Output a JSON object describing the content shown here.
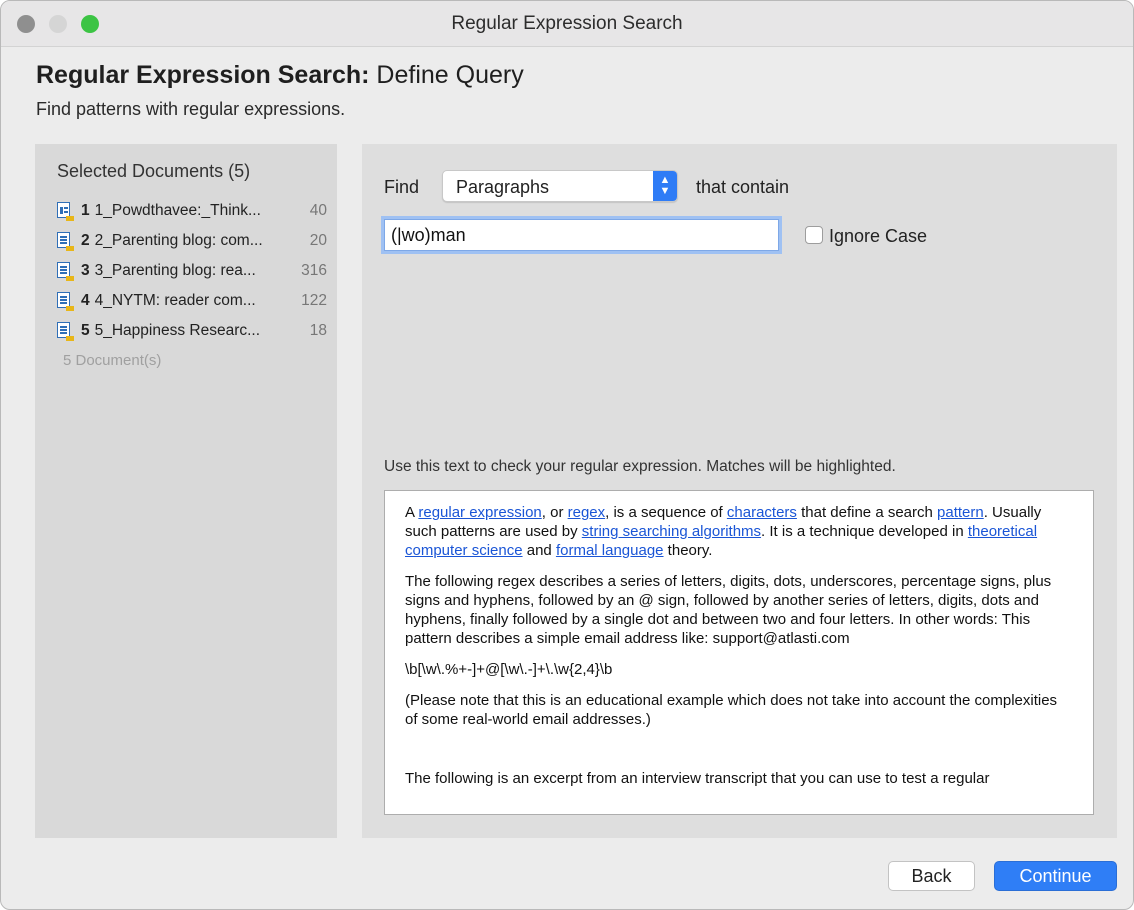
{
  "window": {
    "title": "Regular Expression Search",
    "colors": {
      "close": "#8f8f8f",
      "minimize": "#d5d5d5",
      "maximize": "#3cc444",
      "accent": "#2f7ef6"
    }
  },
  "header": {
    "title_bold": "Regular Expression Search:",
    "title_rest": " Define Query",
    "subtitle": "Find patterns with regular expressions."
  },
  "documents": {
    "title": "Selected Documents (5)",
    "items": [
      {
        "num": "1",
        "name": "1_Powdthavee:_Think...",
        "count": "40",
        "icon": "pdf-document-icon"
      },
      {
        "num": "2",
        "name": "2_Parenting blog: com...",
        "count": "20",
        "icon": "text-document-icon"
      },
      {
        "num": "3",
        "name": "3_Parenting blog: rea...",
        "count": "316",
        "icon": "text-document-icon"
      },
      {
        "num": "4",
        "name": "4_NYTM: reader com...",
        "count": "122",
        "icon": "text-document-icon"
      },
      {
        "num": "5",
        "name": "5_Happiness Researc...",
        "count": "18",
        "icon": "text-document-icon"
      }
    ],
    "footer": "5 Document(s)"
  },
  "query": {
    "find_label": "Find",
    "unit_select": {
      "value": "Paragraphs",
      "icon": "up-down-chevron-icon"
    },
    "contain_label": "that contain",
    "regex_value": "(|wo)man",
    "ignore_case": {
      "label": "Ignore Case",
      "checked": false
    },
    "test_hint": "Use this text to check your regular expression. Matches will be highlighted."
  },
  "test_text": {
    "p1": {
      "t1": "A ",
      "l1": "regular expression",
      "t2": ", or ",
      "l2": "regex",
      "t3": ", is a sequence of ",
      "l3": "characters",
      "t4": " that define a search ",
      "l4": "pattern",
      "t5": ". Usually such patterns are used by ",
      "l5": "string searching algorithms",
      "t6": ". It is a technique developed in ",
      "l6": "theoretical computer science",
      "t7": " and ",
      "l7": "formal language",
      "t8": " theory."
    },
    "p2": "The following regex describes a series of letters, digits, dots, underscores, percentage signs, plus signs and hyphens, followed by an @ sign, followed by another series of letters, digits, dots and hyphens, finally followed by a single dot and between two and four letters. In other words: This pattern describes a simple email address like: support@atlasti.com",
    "p3": "\\b[\\w\\.%+-]+@[\\w\\.-]+\\.\\w{2,4}\\b",
    "p4": "(Please note that this is an educational example which does not take into account the complexities of some real-world email addresses.)",
    "p5": "The following is an excerpt from an interview transcript that you can use to test a regular"
  },
  "footer": {
    "back_label": "Back",
    "continue_label": "Continue"
  }
}
